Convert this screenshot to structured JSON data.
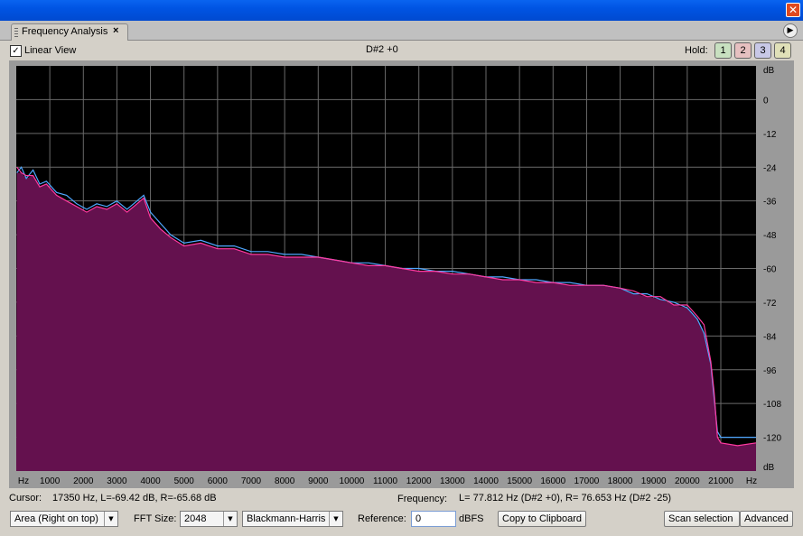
{
  "window": {
    "close_glyph": "✕"
  },
  "tab": {
    "title": "Frequency Analysis",
    "close_glyph": "×"
  },
  "panel_menu_glyph": "▶",
  "toolbar": {
    "linear_view_label": "Linear View",
    "linear_view_checked": true,
    "note_display": "D#2 +0",
    "hold_label": "Hold:",
    "hold_buttons": [
      {
        "label": "1",
        "color": "#c8e0c0"
      },
      {
        "label": "2",
        "color": "#e6c0c0"
      },
      {
        "label": "3",
        "color": "#c8c8e6"
      },
      {
        "label": "4",
        "color": "#e0e0b8"
      }
    ]
  },
  "colors": {
    "fill": "#64114e",
    "left_line": "#4fa7ff",
    "right_line": "#ff3aa0",
    "background": "#000000",
    "grid": "#6a6a6a",
    "ruler": "#9a9a9a"
  },
  "status": {
    "cursor_label": "Cursor:",
    "cursor_value": "17350 Hz, L=-69.42 dB, R=-65.68 dB",
    "frequency_label": "Frequency:",
    "frequency_value": "L= 77.812 Hz (D#2 +0), R= 76.653 Hz (D#2 -25)"
  },
  "controls": {
    "display_mode": "Area (Right on top)",
    "fft_label": "FFT Size:",
    "fft_size": "2048",
    "window_fn": "Blackmann-Harris",
    "reference_label": "Reference:",
    "reference_value": "0",
    "reference_unit": "dBFS",
    "copy_button": "Copy to Clipboard",
    "scan_button": "Scan selection",
    "advanced_button": "Advanced"
  },
  "chart_data": {
    "type": "area",
    "xlabel": "Hz",
    "ylabel": "dB",
    "xlim": [
      0,
      22050
    ],
    "ylim": [
      -132,
      12
    ],
    "x_ticks": [
      1000,
      2000,
      3000,
      4000,
      5000,
      6000,
      7000,
      8000,
      9000,
      10000,
      11000,
      12000,
      13000,
      14000,
      15000,
      16000,
      17000,
      18000,
      19000,
      20000,
      21000
    ],
    "y_ticks": [
      0,
      -12,
      -24,
      -36,
      -48,
      -60,
      -72,
      -84,
      -96,
      -108,
      -120
    ],
    "series": [
      {
        "name": "L",
        "x": [
          20,
          150,
          300,
          500,
          700,
          900,
          1200,
          1500,
          1800,
          2100,
          2400,
          2700,
          3000,
          3300,
          3600,
          3800,
          4000,
          4300,
          4600,
          5000,
          5500,
          6000,
          6500,
          7000,
          7500,
          8000,
          8500,
          9000,
          9500,
          10000,
          10500,
          11000,
          11500,
          12000,
          12500,
          13000,
          13500,
          14000,
          14500,
          15000,
          15500,
          16000,
          16500,
          17000,
          17500,
          18000,
          18400,
          18800,
          19200,
          19600,
          20000,
          20300,
          20500,
          20700,
          20800,
          20900,
          21000,
          21500,
          22050
        ],
        "y": [
          -26,
          -24,
          -28,
          -25,
          -30,
          -29,
          -33,
          -34,
          -37,
          -39,
          -37,
          -38,
          -36,
          -39,
          -36,
          -34,
          -40,
          -44,
          -48,
          -51,
          -50,
          -52,
          -52,
          -54,
          -54,
          -55,
          -55,
          -56,
          -57,
          -58,
          -58,
          -59,
          -60,
          -60,
          -61,
          -61,
          -62,
          -63,
          -63,
          -64,
          -64,
          -65,
          -65,
          -66,
          -66,
          -67,
          -69,
          -69,
          -71,
          -72,
          -74,
          -78,
          -83,
          -94,
          -106,
          -118,
          -120,
          -120,
          -120
        ]
      },
      {
        "name": "R",
        "x": [
          20,
          150,
          300,
          500,
          700,
          900,
          1200,
          1500,
          1800,
          2100,
          2400,
          2700,
          3000,
          3300,
          3600,
          3800,
          4000,
          4300,
          4600,
          5000,
          5500,
          6000,
          6500,
          7000,
          7500,
          8000,
          8500,
          9000,
          9500,
          10000,
          10500,
          11000,
          11500,
          12000,
          12500,
          13000,
          13500,
          14000,
          14500,
          15000,
          15500,
          16000,
          16500,
          17000,
          17500,
          18000,
          18400,
          18800,
          19200,
          19600,
          20000,
          20300,
          20500,
          20700,
          20800,
          20900,
          21000,
          21500,
          22050
        ],
        "y": [
          -24,
          -26,
          -27,
          -27,
          -31,
          -30,
          -34,
          -36,
          -38,
          -40,
          -38,
          -39,
          -37,
          -40,
          -37,
          -35,
          -42,
          -46,
          -49,
          -52,
          -51,
          -53,
          -53,
          -55,
          -55,
          -56,
          -56,
          -56,
          -57,
          -58,
          -59,
          -59,
          -60,
          -61,
          -61,
          -62,
          -62,
          -63,
          -64,
          -64,
          -65,
          -65,
          -66,
          -66,
          -66,
          -67,
          -68,
          -70,
          -70,
          -73,
          -73,
          -77,
          -80,
          -93,
          -104,
          -120,
          -122,
          -123,
          -122
        ]
      }
    ]
  }
}
